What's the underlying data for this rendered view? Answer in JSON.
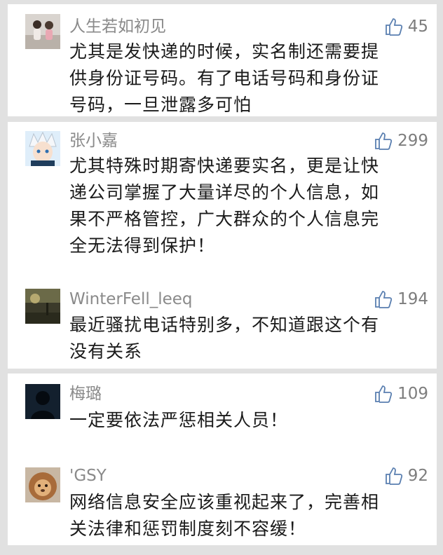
{
  "comments": [
    {
      "name": "人生若如初见",
      "likes": "45",
      "avatar": "children-photo-avatar",
      "lines": [
        "尤其是发快递的时候，实名制还需要提",
        "供身份证号码。有了电话号码和身份证",
        "号码，一旦泄露多可怕"
      ]
    },
    {
      "name": "张小嘉",
      "likes": "299",
      "avatar": "anime-character-avatar",
      "lines": [
        "尤其特殊时期寄快递要实名，更是让快",
        "递公司掌握了大量详尽的个人信息，如",
        "果不严格管控，广大群众的个人信息完",
        "全无法得到保护！"
      ]
    },
    {
      "name": "WinterFell_leeq",
      "likes": "194",
      "avatar": "landscape-photo-avatar",
      "lines": [
        "最近骚扰电话特别多，不知道跟这个有",
        "没有关系"
      ]
    },
    {
      "name": "梅璐",
      "likes": "109",
      "avatar": "silhouette-avatar",
      "lines": [
        "一定要依法严惩相关人员！"
      ]
    },
    {
      "name": "'GSY",
      "likes": "92",
      "avatar": "lion-cartoon-avatar",
      "lines": [
        "网络信息安全应该重视起来了，完善相",
        "关法律和惩罚制度刻不容缓！"
      ]
    }
  ],
  "colors": {
    "background": "#e1e1e1",
    "card": "#ffffff",
    "name": "#8a8a8a",
    "body_text": "#1a1a1a",
    "likes": "#7d7d7d"
  }
}
